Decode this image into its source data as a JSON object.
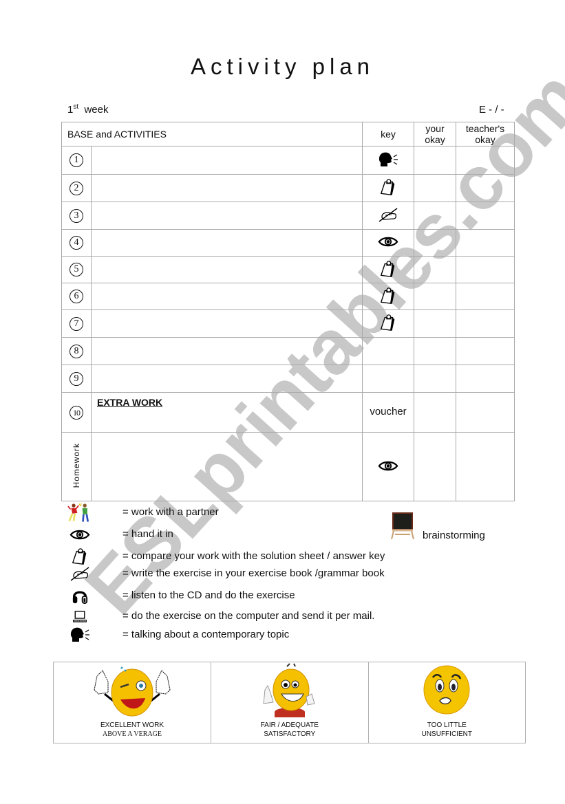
{
  "page": {
    "title": "Activity plan",
    "week_number": "1",
    "week_suffix": "st",
    "week_label": "week",
    "grade_field": "E - / -"
  },
  "table": {
    "headers": {
      "activities": "BASE and ACTIVITIES",
      "key": "key",
      "your_okay": "your\nokay",
      "teachers_okay": "teacher's\nokay"
    },
    "rows": [
      {
        "number": "1",
        "key_icon": "speaking-head-icon",
        "activity": "",
        "key_text": ""
      },
      {
        "number": "2",
        "key_icon": "clipboard-icon",
        "activity": "",
        "key_text": ""
      },
      {
        "number": "3",
        "key_icon": "writing-hand-icon",
        "activity": "",
        "key_text": ""
      },
      {
        "number": "4",
        "key_icon": "eye-icon",
        "activity": "",
        "key_text": ""
      },
      {
        "number": "5",
        "key_icon": "clipboard-icon",
        "activity": "",
        "key_text": ""
      },
      {
        "number": "6",
        "key_icon": "clipboard-icon",
        "activity": "",
        "key_text": ""
      },
      {
        "number": "7",
        "key_icon": "clipboard-icon",
        "activity": "",
        "key_text": ""
      },
      {
        "number": "8",
        "key_icon": "",
        "activity": "",
        "key_text": ""
      },
      {
        "number": "9",
        "key_icon": "",
        "activity": "",
        "key_text": ""
      },
      {
        "number": "10",
        "key_icon": "",
        "activity": "EXTRA WORK",
        "key_text": "voucher"
      }
    ],
    "homework": {
      "label": "Homework",
      "key_icon": "eye-icon",
      "activity": ""
    }
  },
  "legend": [
    {
      "icon": "partners-icon",
      "text": "= work with a partner"
    },
    {
      "icon": "eye-icon",
      "text": "= hand it in"
    },
    {
      "icon": "clipboard-icon",
      "text": "= compare your work with the solution sheet / answer key"
    },
    {
      "icon": "writing-hand-icon",
      "text": "= write the exercise in your exercise book /grammar book"
    },
    {
      "icon": "headphones-icon",
      "text": "= listen to the CD and do the exercise"
    },
    {
      "icon": "computer-icon",
      "text": "= do the exercise on the computer and send it per mail."
    },
    {
      "icon": "speaking-head-icon",
      "text": "= talking about a contemporary topic"
    }
  ],
  "brainstorming": {
    "icon": "blackboard-icon",
    "text": "brainstorming"
  },
  "rating": [
    {
      "icon": "thumbs-up-wink-smiley-icon",
      "line1": "EXCELLENT WORK",
      "line2": "ABOVE A VERAGE"
    },
    {
      "icon": "grinning-thumb-smiley-icon",
      "line1": "FAIR / ADEQUATE",
      "line2": "SATISFACTORY"
    },
    {
      "icon": "worried-smiley-icon",
      "line1": "TOO LITTLE",
      "line2": "UNSUFFICIENT"
    }
  ],
  "watermark": {
    "text": "ESLprintables.com",
    "color": "#c8c8c8"
  }
}
